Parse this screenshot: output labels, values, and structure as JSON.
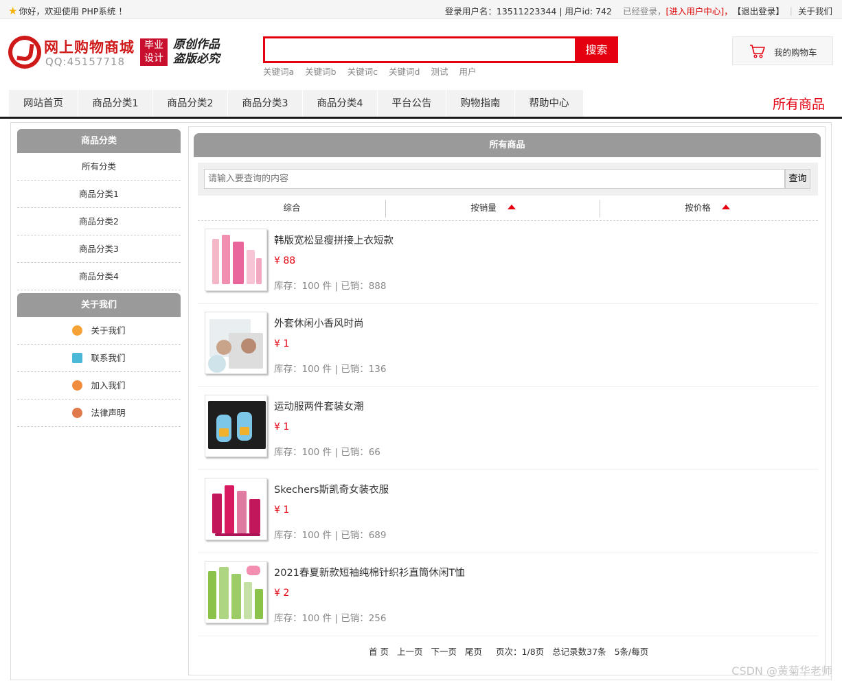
{
  "topbar": {
    "welcome": "你好，欢迎使用 PHP系统 ！",
    "username_label": "登录用户名：13511223344 | 用户id: 742",
    "logged_in": "已经登录，",
    "user_center": "[进入用户中心]，",
    "logout": "【退出登录】",
    "about": "关于我们"
  },
  "header": {
    "site_title": "网上购物商城",
    "qq": "QQ:45157718",
    "badge_line1": "毕业",
    "badge_line2": "设计",
    "slogan_line1": "原创作品",
    "slogan_line2": "盗版必究",
    "search_value": "",
    "search_button": "搜索",
    "keywords": [
      "关键词a",
      "关键词b",
      "关键词c",
      "关键词d",
      "测试",
      "用户"
    ],
    "cart_label": "我的购物车"
  },
  "nav": {
    "items": [
      "网站首页",
      "商品分类1",
      "商品分类2",
      "商品分类3",
      "商品分类4",
      "平台公告",
      "购物指南",
      "帮助中心"
    ],
    "page_heading": "所有商品"
  },
  "sidebar": {
    "category_title": "商品分类",
    "categories": [
      "所有分类",
      "商品分类1",
      "商品分类2",
      "商品分类3",
      "商品分类4"
    ],
    "about_title": "关于我们",
    "about_links": [
      {
        "label": "关于我们",
        "icon": "orange-circle-icon",
        "color": "#f7a234"
      },
      {
        "label": "联系我们",
        "icon": "clipboard-icon",
        "color": "#4bb8d8"
      },
      {
        "label": "加入我们",
        "icon": "lock-icon",
        "color": "#f08c3c"
      },
      {
        "label": "法律声明",
        "icon": "power-icon",
        "color": "#e07a4a"
      }
    ]
  },
  "content": {
    "title": "所有商品",
    "query_placeholder": "请输入要查询的内容",
    "query_button": "查询",
    "sort": [
      "综合",
      "按销量",
      "按价格"
    ],
    "products": [
      {
        "name": "韩版宽松显瘦拼接上衣短款",
        "price": "¥ 88",
        "stock": "库存：100 件 | 已销：888"
      },
      {
        "name": "外套休闲小香风时尚",
        "price": "¥ 1",
        "stock": "库存：100 件 | 已销：136"
      },
      {
        "name": "运动服两件套装女潮",
        "price": "¥ 1",
        "stock": "库存：100 件 | 已销：66"
      },
      {
        "name": "Skechers斯凯奇女装衣服",
        "price": "¥ 1",
        "stock": "库存：100 件 | 已销：689"
      },
      {
        "name": "2021春夏新款短袖纯棉针织衫直筒休闲T恤",
        "price": "¥ 2",
        "stock": "库存：100 件 | 已销：256"
      }
    ],
    "pager": [
      "首 页",
      "上一页",
      "下一页",
      "尾页",
      "页次：1/8页",
      "总记录数37条",
      "5条/每页"
    ]
  },
  "watermark": "CSDN @黄菊华老师",
  "colors": {
    "accent": "#e4000f",
    "header_gray": "#9a9a9a",
    "brand_red": "#d01a1a"
  }
}
